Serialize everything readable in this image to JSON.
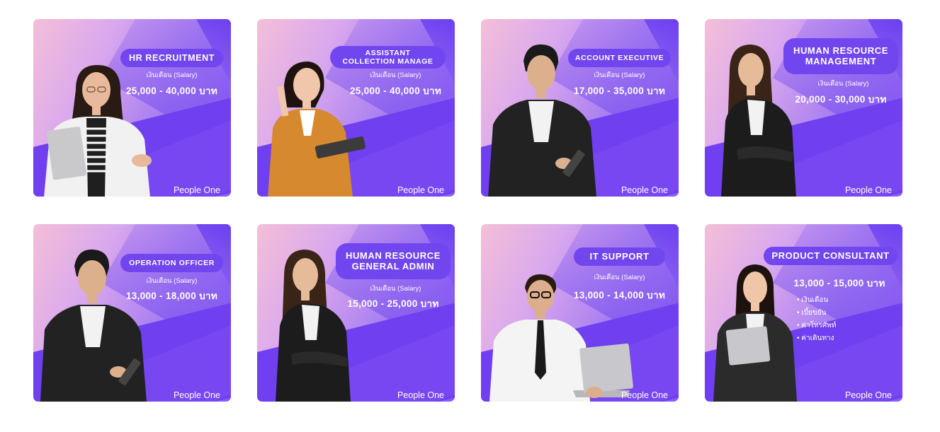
{
  "brand_name": "People One",
  "salary_label": "เงินเดือน (Salary)",
  "colors": {
    "pill": "#7246ee",
    "accent_purple": "#6f3ff0",
    "gradient_pink": "#f4bfd8",
    "gradient_violet": "#8b5cf4"
  },
  "cards": [
    {
      "title": "HR RECRUITMENT",
      "salary": "25,000 - 40,000 บาท",
      "person": "woman-holding-laptop"
    },
    {
      "title": "ASSISTANT\nCOLLECTION MANAGE",
      "salary": "25,000 - 40,000 บาท",
      "person": "woman-with-tablet-and-pen"
    },
    {
      "title": "ACCOUNT EXECUTIVE",
      "salary": "17,000 - 35,000 บาท",
      "person": "man-with-tablet"
    },
    {
      "title": "HUMAN RESOURCE\nMANAGEMENT",
      "salary": "20,000 - 30,000 บาท",
      "person": "woman-arms-crossed"
    },
    {
      "title": "OPERATION OFFICER",
      "salary": "13,000 - 18,000 บาท",
      "person": "man-with-tablet"
    },
    {
      "title": "HUMAN RESOURCE\nGENERAL ADMIN",
      "salary": "15,000 - 25,000 บาท",
      "person": "woman-arms-crossed"
    },
    {
      "title": "IT SUPPORT",
      "salary": "13,000 - 14,000 บาท",
      "person": "man-with-glasses-laptop"
    },
    {
      "title": "PRODUCT CONSULTANT",
      "salary": "13,000 - 15,000 บาท",
      "person": "woman-holding-laptop",
      "benefits": [
        "เงินเดือน",
        "เบี้ยขยัน",
        "ค่าโทรศัพท์",
        "ค่าเดินทาง"
      ]
    }
  ]
}
